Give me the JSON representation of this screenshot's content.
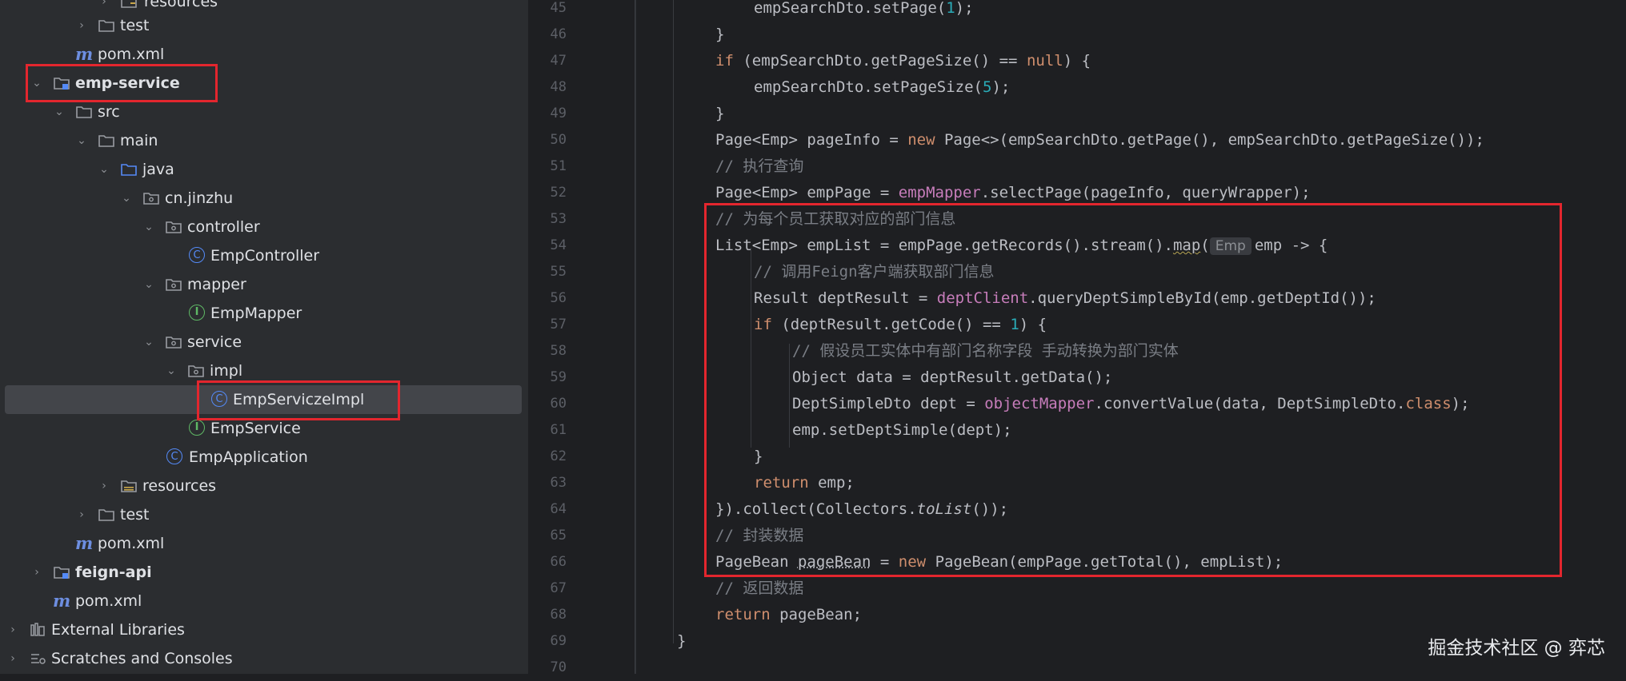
{
  "tree": {
    "items": [
      {
        "label": "resources",
        "icon": "folder-icon",
        "chevron": "right"
      },
      {
        "label": "test",
        "icon": "folder-icon",
        "chevron": "right"
      },
      {
        "label": "pom.xml",
        "icon": "maven-icon"
      },
      {
        "label": "emp-service",
        "icon": "module-folder-icon",
        "chevron": "down",
        "bold": true
      },
      {
        "label": "src",
        "icon": "folder-icon",
        "chevron": "down"
      },
      {
        "label": "main",
        "icon": "folder-icon",
        "chevron": "down"
      },
      {
        "label": "java",
        "icon": "source-folder-icon",
        "chevron": "down"
      },
      {
        "label": "cn.jinzhu",
        "icon": "package-icon",
        "chevron": "down"
      },
      {
        "label": "controller",
        "icon": "package-icon",
        "chevron": "down"
      },
      {
        "label": "EmpController",
        "icon": "class-icon"
      },
      {
        "label": "mapper",
        "icon": "package-icon",
        "chevron": "down"
      },
      {
        "label": "EmpMapper",
        "icon": "interface-icon"
      },
      {
        "label": "service",
        "icon": "package-icon",
        "chevron": "down"
      },
      {
        "label": "impl",
        "icon": "package-icon",
        "chevron": "down"
      },
      {
        "label": "EmpServiczeImpl",
        "icon": "class-icon",
        "selected": true
      },
      {
        "label": "EmpService",
        "icon": "interface-icon"
      },
      {
        "label": "EmpApplication",
        "icon": "spring-class-icon"
      },
      {
        "label": "resources",
        "icon": "resources-folder-icon",
        "chevron": "right"
      },
      {
        "label": "test",
        "icon": "folder-icon",
        "chevron": "right"
      },
      {
        "label": "pom.xml",
        "icon": "maven-icon"
      },
      {
        "label": "feign-api",
        "icon": "module-folder-icon",
        "chevron": "right",
        "bold": true
      },
      {
        "label": "pom.xml",
        "icon": "maven-icon"
      },
      {
        "label": "External Libraries",
        "icon": "libraries-icon",
        "chevron": "right"
      },
      {
        "label": "Scratches and Consoles",
        "icon": "scratches-icon",
        "chevron": "right"
      }
    ]
  },
  "editor": {
    "line_numbers": [
      "45",
      "46",
      "47",
      "48",
      "49",
      "50",
      "51",
      "52",
      "53",
      "54",
      "55",
      "56",
      "57",
      "58",
      "59",
      "60",
      "61",
      "62",
      "63",
      "64",
      "65",
      "66",
      "67",
      "68",
      "69",
      "70"
    ],
    "lines": {
      "l45": {
        "a": "empSearchDto.setPage(",
        "n": "1",
        "b": ");"
      },
      "l46": {
        "a": "}"
      },
      "l47": {
        "kw": "if",
        "a": " (empSearchDto.getPageSize() == ",
        "kw2": "null",
        "b": ") {"
      },
      "l48": {
        "a": "empSearchDto.setPageSize(",
        "n": "5",
        "b": ");"
      },
      "l49": {
        "a": "}"
      },
      "l50": {
        "a": "Page<Emp> pageInfo = ",
        "kw": "new",
        "b": " Page<>(empSearchDto.getPage(), empSearchDto.getPageSize());"
      },
      "l51": {
        "c": "// 执行查询"
      },
      "l52": {
        "a": "Page<Emp> empPage = ",
        "f": "empMapper",
        "b": ".selectPage(pageInfo, queryWrapper);"
      },
      "l53": {
        "c": "// 为每个员工获取对应的部门信息"
      },
      "l54": {
        "a": "List<Emp> empList = empPage.getRecords().stream().",
        "m": "map",
        "p": "(",
        "hint": "Emp",
        "b": "emp -> {"
      },
      "l55": {
        "c": "// 调用Feign客户端获取部门信息"
      },
      "l56": {
        "a": "Result deptResult = ",
        "f": "deptClient",
        "b": ".queryDeptSimpleById(emp.getDeptId());"
      },
      "l57": {
        "kw": "if",
        "a": " (deptResult.getCode() == ",
        "n": "1",
        "b": ") {"
      },
      "l58": {
        "c": "// 假设员工实体中有部门名称字段 手动转换为部门实体"
      },
      "l59": {
        "a": "Object data = deptResult.getData();"
      },
      "l60": {
        "a": "DeptSimpleDto dept = ",
        "f": "objectMapper",
        "b": ".convertValue(data, DeptSimpleDto.",
        "kw": "class",
        "e": ");"
      },
      "l61": {
        "a": "emp.setDeptSimple(dept);"
      },
      "l62": {
        "a": "}"
      },
      "l63": {
        "kw": "return",
        "a": " emp;"
      },
      "l64": {
        "a": "}).collect(Collectors.",
        "i": "toList",
        "b": "());"
      },
      "l65": {
        "c": "// 封装数据"
      },
      "l66": {
        "a": "PageBean ",
        "u": "pageBean",
        "b": " = ",
        "kw": "new",
        "e": " PageBean(empPage.getTotal(), empList);"
      },
      "l67": {
        "c": "// 返回数据"
      },
      "l68": {
        "kw": "return",
        "a": " pageBean;"
      },
      "l69": {
        "a": "}"
      }
    }
  },
  "watermark": "掘金技术社区 @ 弈芯",
  "colors": {
    "highlight_box": "#e3262e",
    "keyword": "#cf8e6d",
    "field": "#c77dbb",
    "number": "#2aacb8",
    "comment": "#7a7e85"
  }
}
